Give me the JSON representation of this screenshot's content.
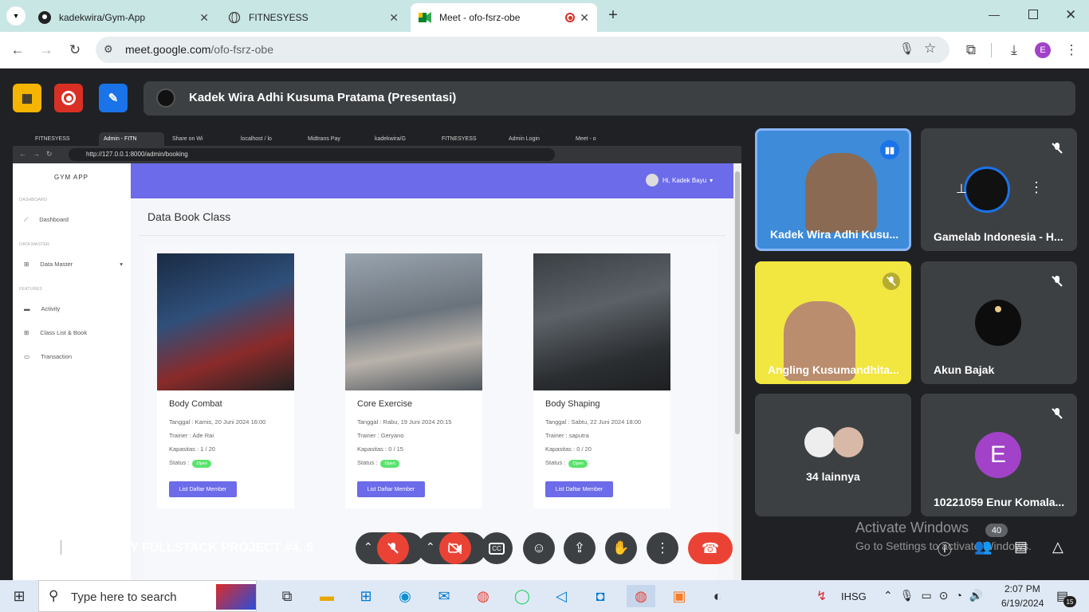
{
  "browser": {
    "tabs": [
      {
        "title": "kadekwira/Gym-App"
      },
      {
        "title": "FITNESYESS"
      },
      {
        "title": "Meet - ofo-fsrz-obe"
      }
    ],
    "url_host": "meet.google.com",
    "url_path": "/ofo-fsrz-obe"
  },
  "meet": {
    "presenter": "Kadek Wira Adhi Kusuma Pratama (Presentasi)",
    "time": "14.07",
    "meeting_title": "DEMO DAY FULLSTACK PROJECT #4, 5",
    "participant_count": "40",
    "participants": [
      {
        "name": "Kadek Wira Adhi Kusu...",
        "speaking": true
      },
      {
        "name": "Gamelab Indonesia - H...",
        "muted": true
      },
      {
        "name": "Angling Kusumandhita...",
        "muted": true
      },
      {
        "name": "Akun Bajak",
        "muted": true
      },
      {
        "name": "34 lainnya"
      },
      {
        "name": "10221059 Enur Komala...",
        "initial": "E",
        "muted": true
      }
    ],
    "watermark_title": "Activate Windows",
    "watermark_sub": "Go to Settings to activate Windows."
  },
  "shared": {
    "tabs": [
      "FITNESYESS",
      "Admin - FITN",
      "Share on Wi",
      "localhost / lo",
      "Midtrans Pay",
      "kadekwira/G",
      "FITNESYESS",
      "Admin Login",
      "Meet - o"
    ],
    "url": "http://127.0.0.1:8000/admin/booking",
    "brand": "GYM APP",
    "user": "Hi, Kadek Bayu",
    "sidebar": {
      "section_dashboard": "DASHBOARD",
      "dashboard": "Dashboard",
      "section_master": "DATA MASTER",
      "data_master": "Data Master",
      "section_features": "FEATURES",
      "activity": "Activity",
      "class_list": "Class List & Book",
      "transaction": "Transaction"
    },
    "page_title": "Data Book Class",
    "classes": [
      {
        "name": "Body Combat",
        "tanggal": "Tanggal : Kamis, 20 Juni 2024 16:00",
        "trainer": "Trainer : Ade Rai",
        "kapasitas": "Kapasitas : 1 / 20",
        "status_label": "Status :",
        "status": "Open",
        "button": "List Daftar Member"
      },
      {
        "name": "Core Exercise",
        "tanggal": "Tanggal : Rabu, 19 Juni 2024 20:15",
        "trainer": "Trainer : Geryano",
        "kapasitas": "Kapasitas : 0 / 15",
        "status_label": "Status :",
        "status": "Open",
        "button": "List Daftar Member"
      },
      {
        "name": "Body Shaping",
        "tanggal": "Tanggal : Sabtu, 22 Juni 2024 18:00",
        "trainer": "Trainer : saputra",
        "kapasitas": "Kapasitas : 0 / 20",
        "status_label": "Status :",
        "status": "Open",
        "button": "List Daftar Member"
      }
    ]
  },
  "taskbar": {
    "search_placeholder": "Type here to search",
    "stock": "IHSG",
    "time": "2:07 PM",
    "date": "6/19/2024",
    "notifications": "15"
  }
}
